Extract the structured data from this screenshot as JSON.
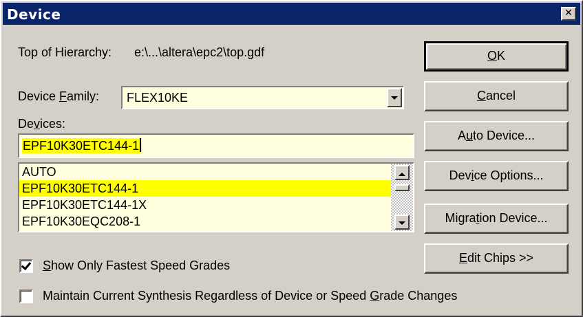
{
  "window": {
    "title": "Device",
    "close_glyph": "✕"
  },
  "hierarchy": {
    "label": "Top of Hierarchy:",
    "value": "e:\\...\\altera\\epc2\\top.gdf"
  },
  "family": {
    "label_pre": "Device ",
    "label_key": "F",
    "label_post": "amily:",
    "value": "FLEX10KE"
  },
  "devices": {
    "label_pre": "De",
    "label_key": "v",
    "label_post": "ices:",
    "input_value": "EPF10K30ETC144-1",
    "list": [
      "AUTO",
      "EPF10K30ETC144-1",
      "EPF10K30ETC144-1X",
      "EPF10K30EQC208-1"
    ],
    "selected_index": 1
  },
  "buttons": {
    "ok": {
      "key": "O",
      "rest": "K"
    },
    "cancel": {
      "key": "C",
      "rest": "ancel"
    },
    "auto_device": {
      "pre": "A",
      "key": "u",
      "post": "to Device..."
    },
    "device_options": {
      "pre": "Dev",
      "key": "i",
      "post": "ce Options..."
    },
    "migration_device": {
      "pre": "Migra",
      "key": "t",
      "post": "ion Device..."
    },
    "edit_chips": {
      "key": "E",
      "post": "dit Chips >>"
    }
  },
  "options": {
    "show_fastest": {
      "key": "S",
      "post": "how Only Fastest Speed Grades",
      "checked": true
    },
    "maintain_synthesis": {
      "pre": "Maintain Current Synthesis Regardless of Device or Speed ",
      "key": "G",
      "post": "rade Changes",
      "checked": false
    }
  },
  "colors": {
    "title_bg": "#0a246a",
    "field_bg": "#ffffe0",
    "highlight": "#ffff00",
    "face": "#d4d0c8"
  }
}
